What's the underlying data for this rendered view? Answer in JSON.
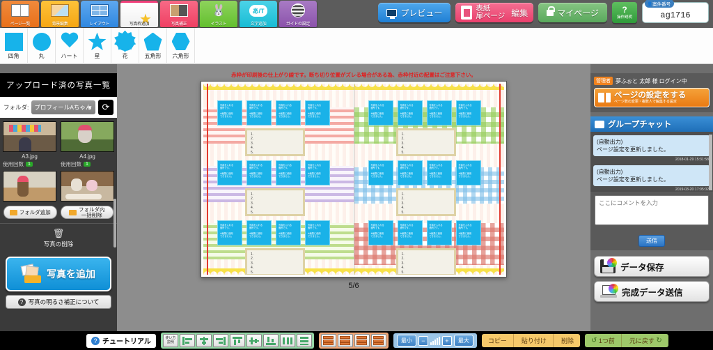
{
  "toolbar": {
    "tabs": [
      {
        "label": "ページ一覧",
        "icon": "book-icon",
        "style": "tt-orange"
      },
      {
        "label": "背景編集",
        "icon": "background-edit-icon",
        "style": "tt-yellow"
      },
      {
        "label": "レイアウト",
        "icon": "layout-icon",
        "style": "tt-blue"
      },
      {
        "label": "写真枠追加",
        "icon": "star-frame-icon",
        "style": "tt-white"
      },
      {
        "label": "写真補正",
        "icon": "photo-correction-icon",
        "style": "tt-pink"
      },
      {
        "label": "イラスト",
        "icon": "illustration-icon",
        "style": "tt-green"
      },
      {
        "label": "文字追加",
        "icon": "text-add-icon",
        "style": "tt-cyan"
      },
      {
        "label": "ガイドの設定",
        "icon": "guide-setting-icon",
        "style": "tt-purple"
      }
    ]
  },
  "shapes": [
    {
      "label": "四角",
      "shape": "square-shape-icon",
      "cls": ""
    },
    {
      "label": "丸",
      "shape": "circle-shape-icon",
      "cls": "s-circle"
    },
    {
      "label": "ハート",
      "shape": "heart-shape-icon",
      "cls": "s-heart"
    },
    {
      "label": "星",
      "shape": "star-shape-icon",
      "cls": "s-star"
    },
    {
      "label": "花",
      "shape": "flower-shape-icon",
      "cls": "s-flower"
    },
    {
      "label": "五角形",
      "shape": "pentagon-shape-icon",
      "cls": "s-penta"
    },
    {
      "label": "六角形",
      "shape": "hexagon-shape-icon",
      "cls": "s-hexa"
    }
  ],
  "header": {
    "preview": "プレビュー",
    "cover_line1": "表紙",
    "cover_line2": "扉ページ",
    "cover_edit": "編集",
    "mypage": "マイページ",
    "help_mark": "?",
    "help_label": "操作説明",
    "case_label": "案件番号",
    "case_value": "ag1716"
  },
  "sidebar": {
    "title": "アップロード済の写真一覧",
    "folder_label": "フォルダ:",
    "folder_value": "プロフィールAちゃん",
    "refresh_icon": "refresh-icon",
    "photos": [
      {
        "name": "A3.jpg",
        "use_label": "使用回数",
        "use_count": "1"
      },
      {
        "name": "A4.jpg",
        "use_label": "使用回数",
        "use_count": "1"
      },
      {
        "name": "",
        "use_label": "",
        "use_count": ""
      },
      {
        "name": "",
        "use_label": "",
        "use_count": ""
      }
    ],
    "add_folder": "フォルダ追加",
    "delete_folder_l1": "フォルダ内",
    "delete_folder_l2": "一括削除",
    "delete_photo": "写真の削除",
    "add_photo": "写真を追加",
    "brightness": "写真の明るさ補正について"
  },
  "canvas": {
    "warning": "赤枠が印刷後の仕上がり線です。断ち切り位置がズレる場合がある為、赤枠付近の配置はご注意下さい。",
    "page_number": "5/6",
    "photo_placeholder_l1": "写真を入れる",
    "photo_placeholder_l2": "箇所です。",
    "photo_placeholder_l3": "※編集に使用",
    "photo_placeholder_l4": "できません。",
    "text_lines": [
      "1.",
      "2.",
      "3.",
      "4.",
      "5."
    ]
  },
  "right": {
    "admin_badge": "管理者",
    "admin_name": "夢ふぉと 太郎 様 ログイン中",
    "page_setting_main": "ページの設定をする",
    "page_setting_sub": "ページ数の変更・複数人で編集する設定",
    "chat_title": "グループチャット",
    "messages": [
      {
        "line1": "(自動出力)",
        "line2": "ページ設定を更新しました。",
        "time": "2018-01-29 15:31:58"
      },
      {
        "line1": "(自動出力)",
        "line2": "ページ設定を更新しました。",
        "time": "2019-03-20 17:05:02"
      }
    ],
    "comment_placeholder": "ここにコメントを入力",
    "send": "送信",
    "save_data": "データ保存",
    "send_data": "完成データ送信"
  },
  "bottom": {
    "tutorial": "チュートリアル",
    "howto_l1": "使い方",
    "howto_l2": "説明",
    "align_buttons": [
      "align-left",
      "align-center-h",
      "align-right",
      "align-top",
      "align-middle",
      "align-bottom",
      "distribute-h",
      "distribute-v"
    ],
    "layer_buttons": [
      "bring-to-front",
      "bring-forward",
      "send-backward",
      "send-to-back"
    ],
    "zoom_min": "最小",
    "zoom_max": "最大",
    "zoom_out_icon": "zoom-out-icon",
    "zoom_in_icon": "zoom-in-icon",
    "copy": "コピー",
    "paste": "貼り付け",
    "delete": "削除",
    "undo": "1つ前",
    "redo": "元に戻す"
  },
  "colors": {
    "accent_blue": "#1f7fd4",
    "accent_orange": "#ea7a12",
    "photo_slot": "#1ab2e8",
    "warning_red": "#e02020"
  }
}
